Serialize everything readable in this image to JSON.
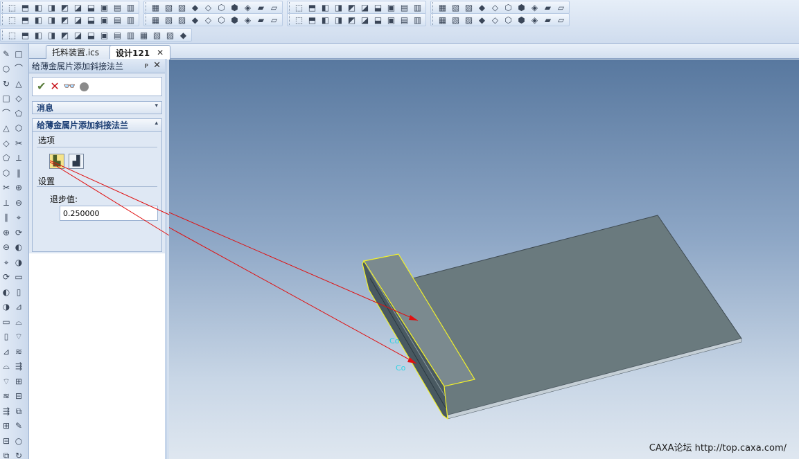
{
  "toolbar": {
    "row1": [
      "new-icon",
      "open-icon",
      "save-icon",
      "undo-icon",
      "redo-icon",
      "cut-icon",
      "copy-icon",
      "paste-icon",
      "print-icon",
      "rotate-icon",
      "pan-icon",
      "zoom-icon",
      "fit-icon",
      "view-icon",
      "shade-icon",
      "wire-icon",
      "box-icon",
      "cylinder-icon",
      "sphere-icon",
      "cone-icon",
      "torus-icon",
      "extrude-icon",
      "revolve-icon",
      "sweep-icon",
      "loft-icon",
      "shell-icon",
      "fillet-icon",
      "chamfer-icon",
      "draft-icon",
      "hole-icon",
      "thread-icon",
      "pattern-icon",
      "mirror-icon",
      "sheet-icon",
      "bend-icon",
      "flange-icon",
      "hem-icon",
      "tab-icon",
      "relief-icon",
      "unfold-icon"
    ],
    "row2": [
      "sketch-icon",
      "plane-icon",
      "axis-icon",
      "point-icon",
      "measure-icon",
      "section-icon",
      "explode-icon",
      "assembly-icon",
      "part-icon",
      "mate-icon",
      "constraint-icon",
      "insert-icon",
      "drag-icon",
      "align-icon",
      "offset-icon",
      "split-icon",
      "merge-icon",
      "scale-icon",
      "move-icon",
      "copy3d-icon",
      "stack-icon",
      "layer-icon",
      "attr-icon",
      "color-icon",
      "render-icon",
      "light-icon",
      "camera-icon",
      "anim-icon",
      "sim-icon",
      "report-icon",
      "bom-icon",
      "check-icon",
      "analysis-icon",
      "interfere-icon",
      "gap-icon",
      "mass-icon",
      "export-icon",
      "import-icon",
      "options-icon",
      "help-icon"
    ],
    "row3": [
      "surface-icon",
      "patch-icon",
      "blend-icon",
      "trim-icon",
      "extend-icon",
      "knit-icon",
      "thicken-icon",
      "offsetface-icon",
      "deleteface-icon",
      "replace-icon",
      "move-face-icon",
      "stitch-icon",
      "heal-icon",
      "split-face-icon"
    ]
  },
  "doc_tabs": [
    {
      "label": "托料装置.ics",
      "active": false
    },
    {
      "label": "设计121",
      "active": true
    }
  ],
  "panel": {
    "title": "给薄金属片添加斜接法兰",
    "message_section": "消息",
    "feature_section": "给薄金属片添加斜接法兰",
    "options_label": "选项",
    "settings_label": "设置",
    "setback_label": "退步值:",
    "setback_value": "0.250000"
  },
  "viewport": {
    "labels": [
      "Co",
      "Co"
    ],
    "watermark": "CAXA论坛 http://top.caxa.com/"
  },
  "colors": {
    "annotation_line": "#e01010",
    "highlight": "#f2f22a",
    "label": "#2fd2e2",
    "part_top": "#6a7a7e",
    "part_side": "#4a5a61"
  }
}
